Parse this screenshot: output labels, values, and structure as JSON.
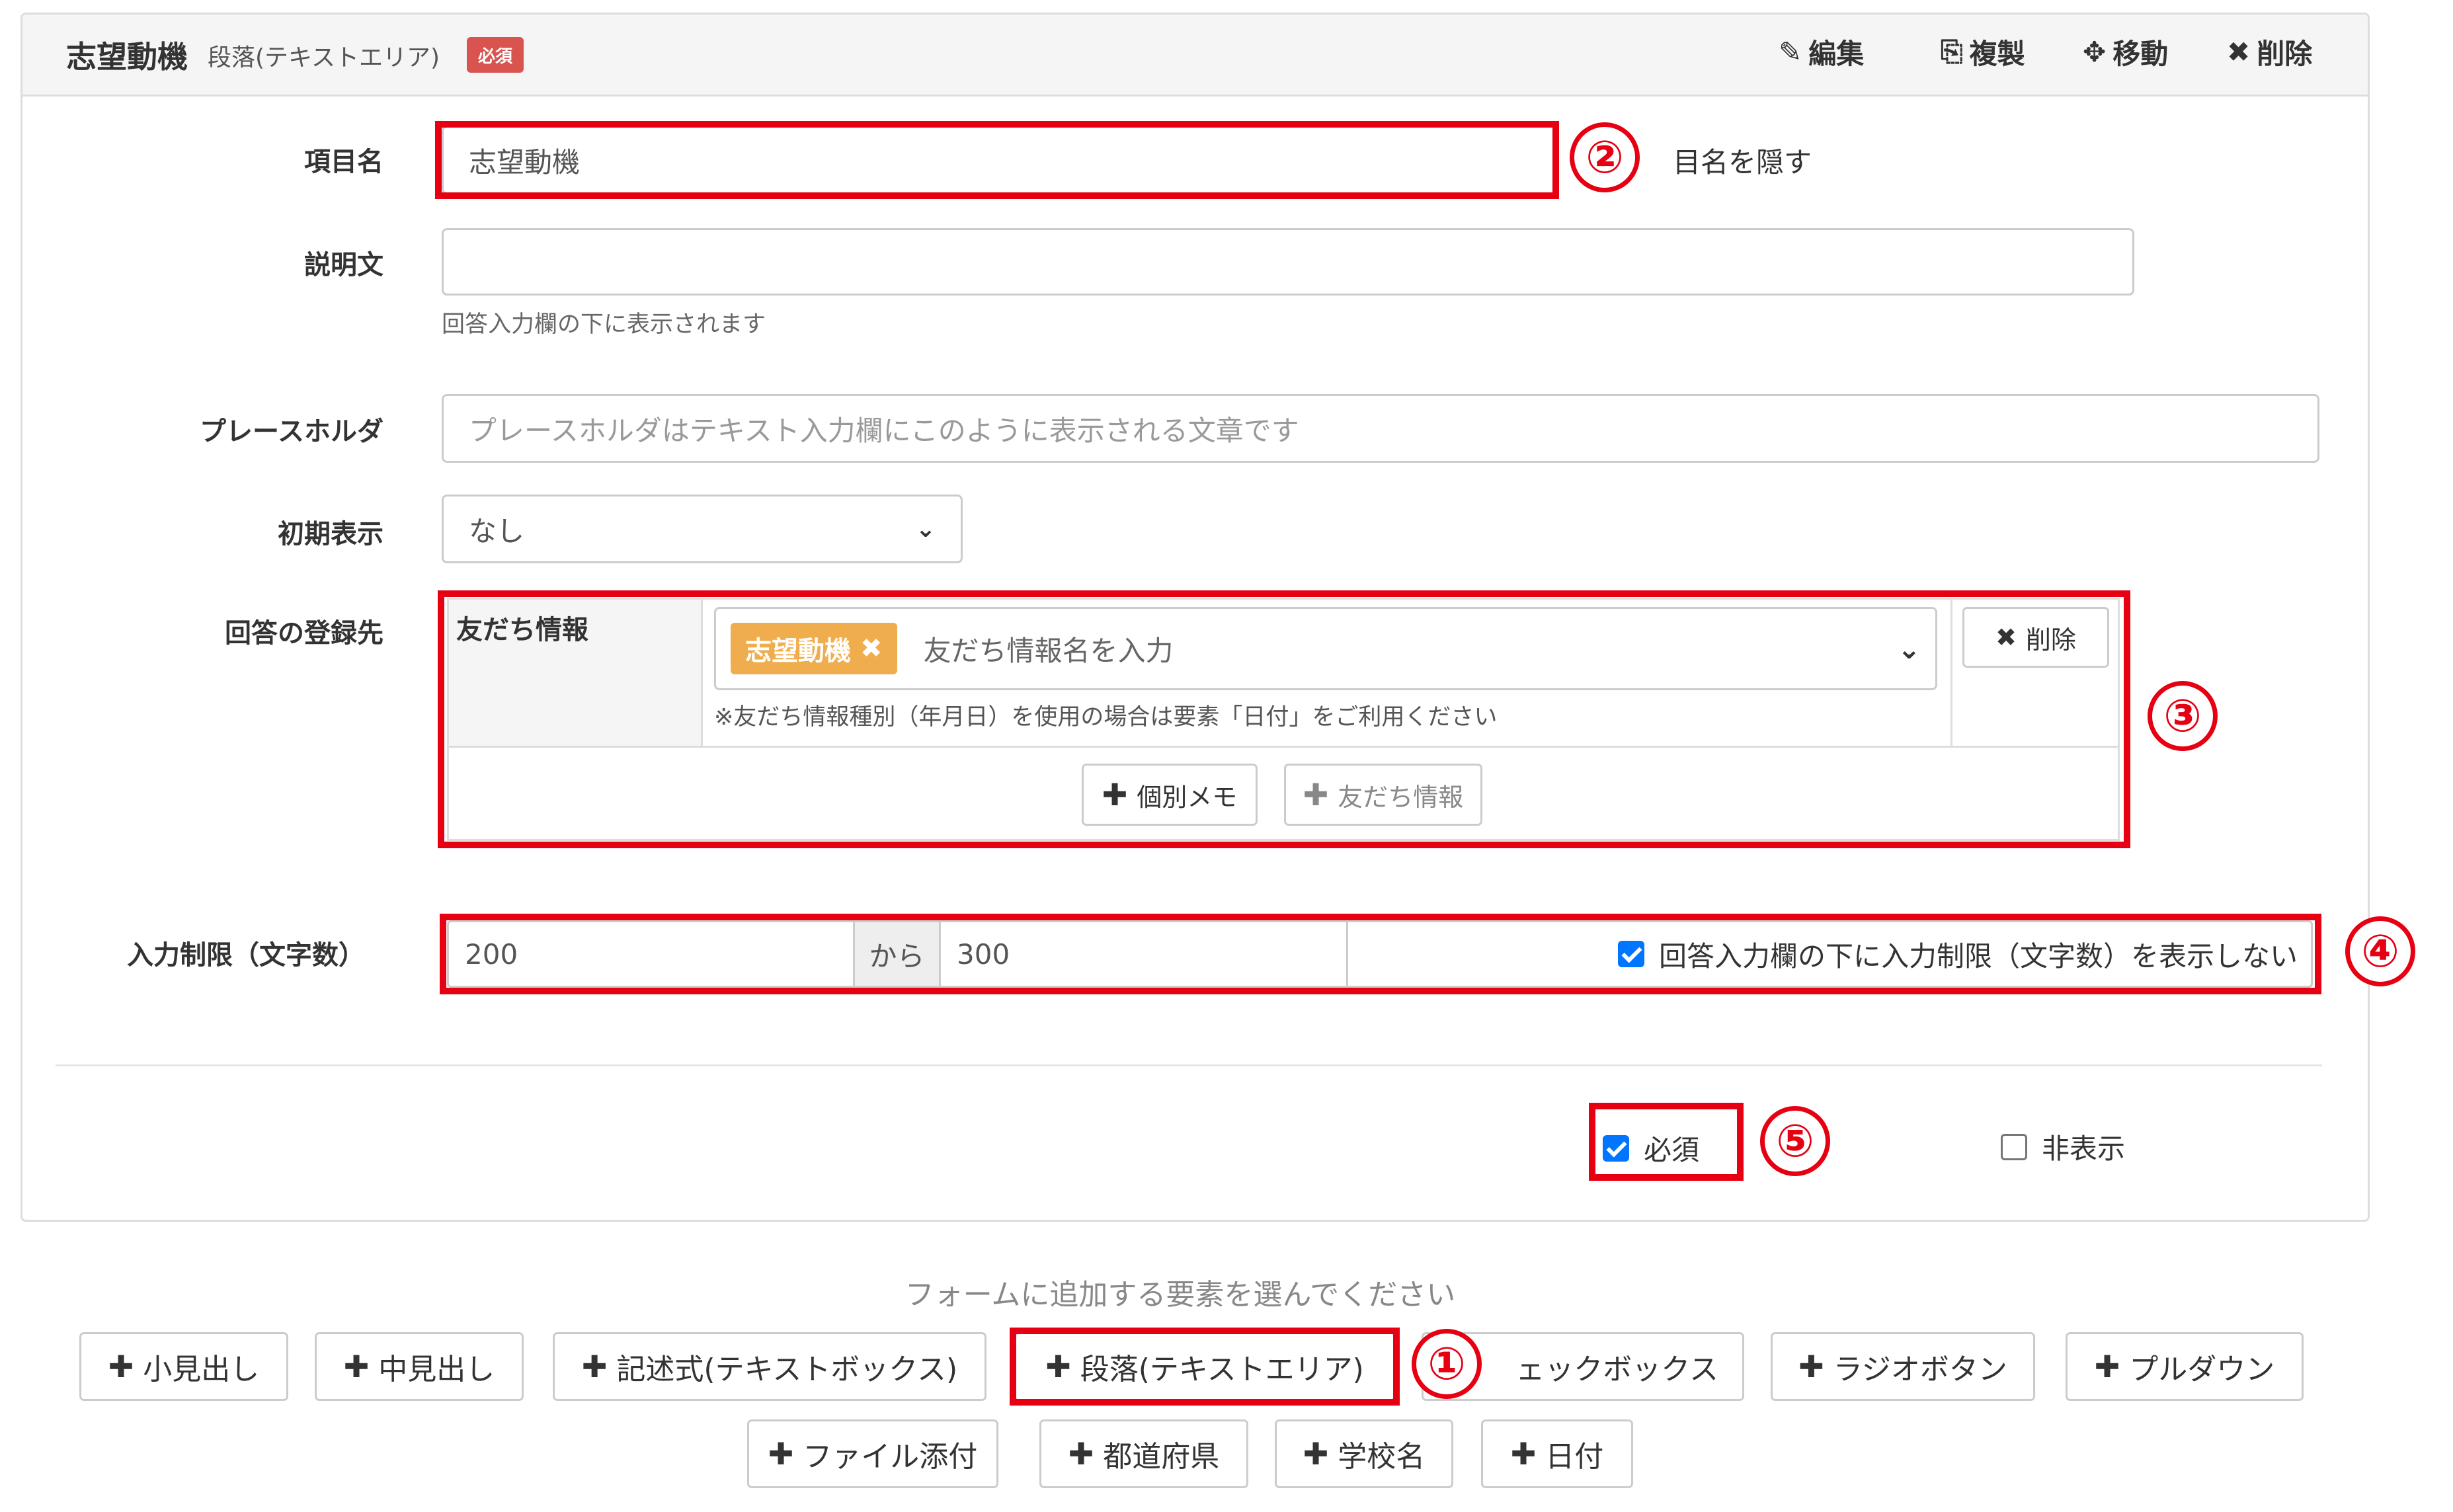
{
  "header": {
    "title": "志望動機",
    "subtitle": "段落(テキストエリア)",
    "required_badge": "必須",
    "actions": {
      "edit": "編集",
      "duplicate": "複製",
      "move": "移動",
      "delete": "削除"
    }
  },
  "fields": {
    "item_name": {
      "label": "項目名",
      "value": "志望動機",
      "hide_label_text": "目名を隠す"
    },
    "description": {
      "label": "説明文",
      "value": "",
      "help": "回答入力欄の下に表示されます"
    },
    "placeholder": {
      "label": "プレースホルダ",
      "placeholder": "プレースホルダはテキスト入力欄にこのように表示される文章です"
    },
    "initial_display": {
      "label": "初期表示",
      "selected": "なし"
    },
    "answer_destination": {
      "label": "回答の登録先",
      "table_header": "友だち情報",
      "tag": "志望動機",
      "input_placeholder": "友だち情報名を入力",
      "delete_label": "削除",
      "note": "※友だち情報種別（年月日）を使用の場合は要素「日付」をご利用ください",
      "add_memo": "個別メモ",
      "add_friend_info": "友だち情報"
    },
    "input_limit": {
      "label": "入力制限（文字数）",
      "min": "200",
      "separator": "から",
      "max": "300",
      "hide_limit_checked": true,
      "hide_limit_label": "回答入力欄の下に入力制限（文字数）を表示しない"
    },
    "required": {
      "checked": true,
      "label": "必須"
    },
    "hidden": {
      "checked": false,
      "label": "非表示"
    }
  },
  "add_elements": {
    "prompt": "フォームに追加する要素を選んでください",
    "row1": [
      "小見出し",
      "中見出し",
      "記述式(テキストボックス)",
      "段落(テキストエリア)",
      "ェックボックス",
      "ラジオボタン",
      "プルダウン"
    ],
    "row2": [
      "ファイル添付",
      "都道府県",
      "学校名",
      "日付"
    ]
  },
  "annotations": [
    "①",
    "②",
    "③",
    "④",
    "⑤"
  ],
  "colors": {
    "highlight": "#e60012",
    "badge": "#d9534f",
    "tag": "#f0ad4e",
    "checkbox": "#0075ff"
  }
}
